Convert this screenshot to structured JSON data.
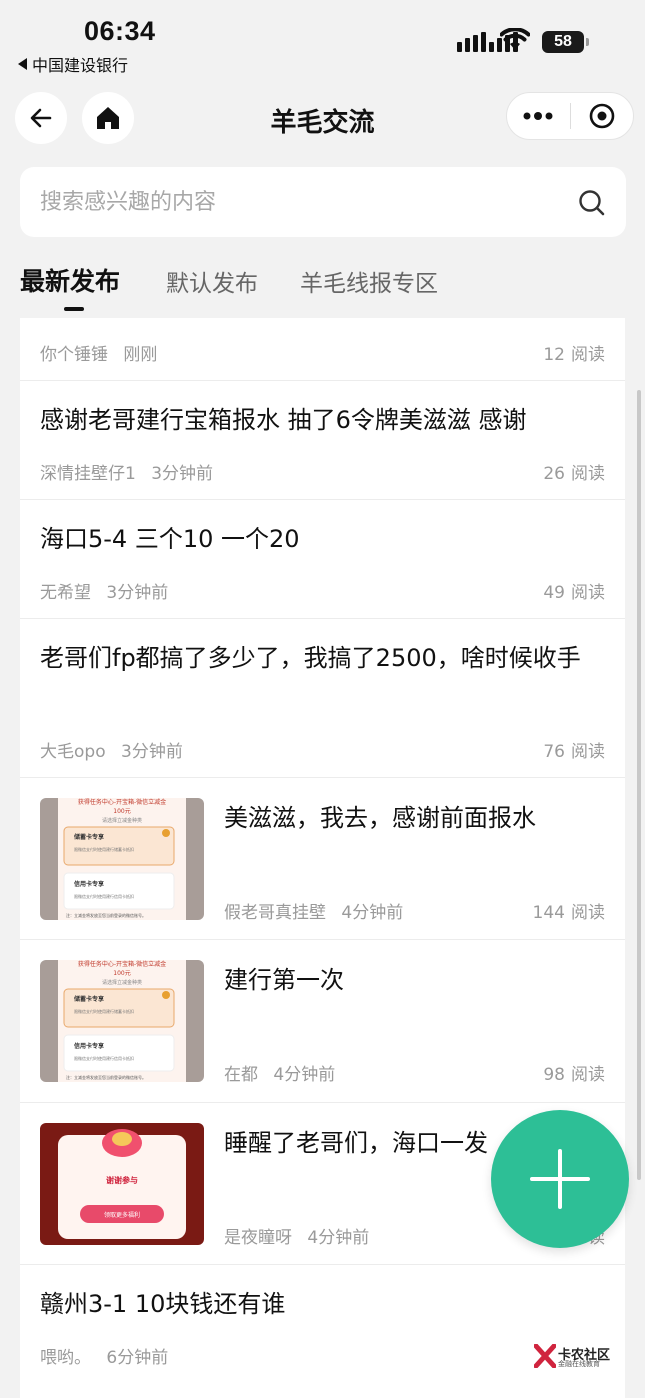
{
  "status_bar": {
    "time": "06:34",
    "back_app": "中国建设银行",
    "battery": "58"
  },
  "nav": {
    "title": "羊毛交流"
  },
  "search": {
    "placeholder": "搜索感兴趣的内容"
  },
  "tabs": [
    {
      "label": "最新发布",
      "active": true
    },
    {
      "label": "默认发布",
      "active": false
    },
    {
      "label": "羊毛线报专区",
      "active": false
    }
  ],
  "reads_suffix": "阅读",
  "posts": [
    {
      "title": "",
      "author": "你个锤锤",
      "time": "刚刚",
      "reads": "12"
    },
    {
      "title": "感谢老哥建行宝箱报水 抽了6令牌美滋滋 感谢",
      "author": "深情挂壁仔1",
      "time": "3分钟前",
      "reads": "26"
    },
    {
      "title": "海口5-4 三个10 一个20",
      "author": "无希望",
      "time": "3分钟前",
      "reads": "49"
    },
    {
      "title": "老哥们fp都搞了多少了，我搞了2500，啥时候收手",
      "author": "大毛opo",
      "time": "3分钟前",
      "reads": "76"
    },
    {
      "title": "美滋滋，我去，感谢前面报水",
      "author": "假老哥真挂壁",
      "time": "4分钟前",
      "reads": "144"
    },
    {
      "title": "建行第一次",
      "author": "在都",
      "time": "4分钟前",
      "reads": "98"
    },
    {
      "title": "睡醒了老哥们，海口一发",
      "author": "是夜瞳呀",
      "time": "4分钟前",
      "reads": "读"
    },
    {
      "title": "赣州3-1 10块钱还有谁",
      "author": "喂哟。",
      "time": "6分钟前",
      "reads": ""
    }
  ],
  "thumbs": {
    "task_card": {
      "header": "获得任务中心-开宝箱-微信立减金",
      "amount": "100元",
      "subtitle": "请选择立减金种类",
      "option1_title": "储蓄卡专享",
      "option1_desc": "限微信支付时使用建行储蓄卡抵扣",
      "option2_title": "信用卡专享",
      "option2_desc": "限微信支付时使用建行信用卡抵扣",
      "note": "注：立减金将发放至您当前登录的微信账号。"
    },
    "prize_card": {
      "title": "谢谢参与",
      "button": "领取更多福利"
    }
  },
  "watermark": {
    "text": "卡农社区",
    "sub": "金融在线教育"
  },
  "colors": {
    "fab": "#2dbf96",
    "background": "#f2f2f2",
    "meta": "#9a9a9a"
  }
}
